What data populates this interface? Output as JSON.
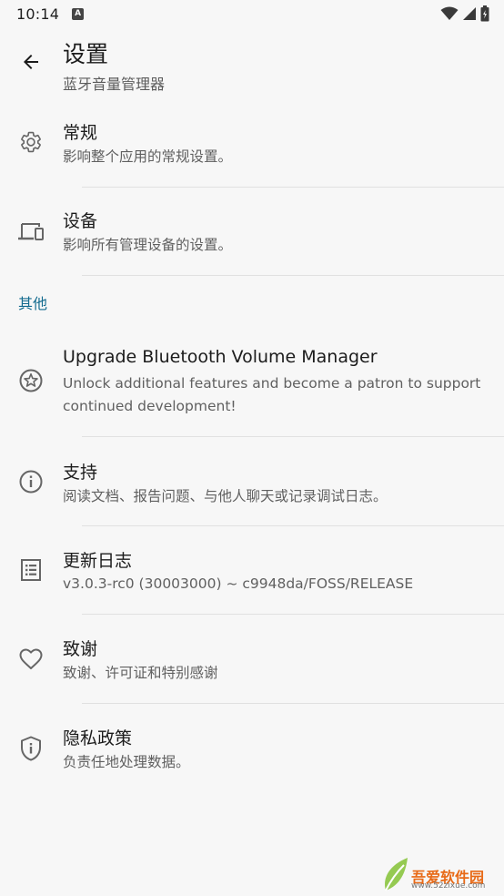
{
  "status_bar": {
    "time": "10:14",
    "notification_letter": "A"
  },
  "app_bar": {
    "title": "设置",
    "subtitle": "蓝牙音量管理器"
  },
  "general": {
    "title": "常规",
    "summary": "影响整个应用的常规设置。"
  },
  "devices": {
    "title": "设备",
    "summary": "影响所有管理设备的设置。"
  },
  "other_header": "其他",
  "upgrade": {
    "title": "Upgrade Bluetooth Volume Manager",
    "summary": "Unlock additional features and become a patron to support continued development!"
  },
  "support": {
    "title": "支持",
    "summary": "阅读文档、报告问题、与他人聊天或记录调试日志。"
  },
  "changelog": {
    "title": "更新日志",
    "summary": "v3.0.3-rc0 (30003000) ~ c9948da/FOSS/RELEASE"
  },
  "acknowledgements": {
    "title": "致谢",
    "summary": "致谢、许可证和特别感谢"
  },
  "privacy": {
    "title": "隐私政策",
    "summary": "负责任地处理数据。"
  },
  "watermark": {
    "name": "吾爱软件园",
    "url": "www.52zixue.com"
  },
  "colors": {
    "background": "#f7f7f7",
    "accent": "#136b8f",
    "icon": "#666666"
  }
}
